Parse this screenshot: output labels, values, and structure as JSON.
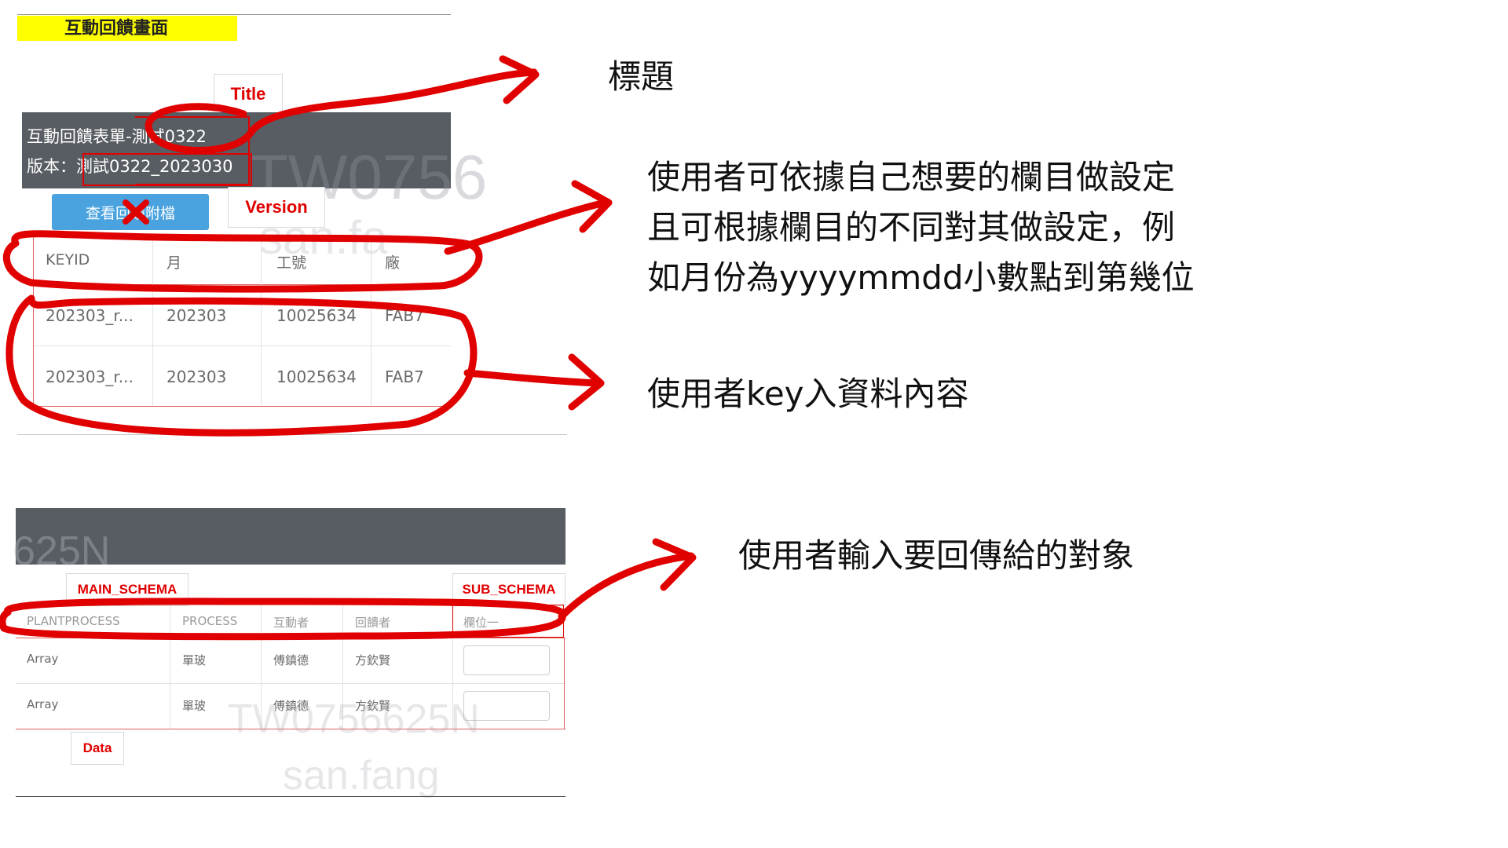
{
  "top": {
    "section_title": "互動回饋畫面",
    "form_title": "互動回饋表單-測試0322",
    "version_line": "版本：測試0322_2023030",
    "view_button": "查看回饋附檔",
    "watermark_1": "TW0756",
    "watermark_2": "san.fa",
    "tag_title": "Title",
    "tag_version": "Version",
    "columns": [
      "KEYID",
      "月",
      "工號",
      "廠"
    ],
    "rows": [
      [
        "202303_r...",
        "202303",
        "10025634",
        "FAB7"
      ],
      [
        "202303_r...",
        "202303",
        "10025634",
        "FAB7"
      ]
    ]
  },
  "bottom": {
    "banner_watermark": "625N",
    "tag_main_schema": "MAIN_SCHEMA",
    "tag_sub_schema": "SUB_SCHEMA",
    "tag_data": "Data",
    "columns": [
      "PLANTPROCESS",
      "PROCESS",
      "互動者",
      "回饋者",
      "欄位一"
    ],
    "rows": [
      [
        "Array",
        "單玻",
        "傅鎮德",
        "方欽賢",
        ""
      ],
      [
        "Array",
        "單玻",
        "傅鎮德",
        "方欽賢",
        ""
      ]
    ],
    "watermark_1": "TW0756625N",
    "watermark_2": "san.fang"
  },
  "notes": {
    "title_note": "標題",
    "column_note_1": "使用者可依據自己想要的欄目做設定",
    "column_note_2": "且可根據欄目的不同對其做設定，例",
    "column_note_3": "如月份為yyyymmdd小數點到第幾位",
    "data_note": "使用者key入資料內容",
    "schema_note": "使用者輸入要回傳給的對象"
  },
  "colors": {
    "annotation_red": "#e00000",
    "highlight_yellow": "#ffff00",
    "header_bar": "#585d63",
    "button_blue": "#4aa3df"
  }
}
